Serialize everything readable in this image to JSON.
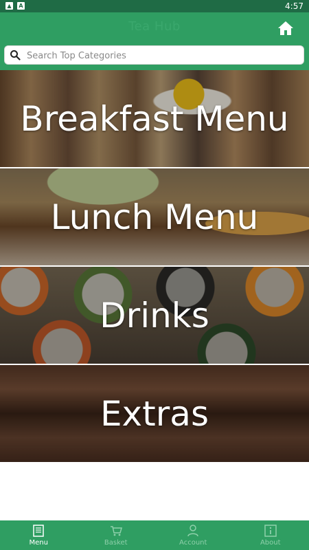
{
  "status_bar": {
    "time": "4:57"
  },
  "header": {
    "title": "Tea Hub",
    "search_placeholder": "Search Top Categories"
  },
  "categories": [
    {
      "label": "Breakfast Menu"
    },
    {
      "label": "Lunch Menu"
    },
    {
      "label": "Drinks"
    },
    {
      "label": "Extras"
    }
  ],
  "bottom_nav": [
    {
      "label": "Menu",
      "icon": "menu-book-icon",
      "active": true
    },
    {
      "label": "Basket",
      "icon": "basket-icon",
      "active": false
    },
    {
      "label": "Account",
      "icon": "account-icon",
      "active": false
    },
    {
      "label": "About",
      "icon": "info-icon",
      "active": false
    }
  ],
  "colors": {
    "primary": "#2f9e62",
    "status_bar": "#1f6b45",
    "nav_inactive": "#8fd0ab"
  }
}
